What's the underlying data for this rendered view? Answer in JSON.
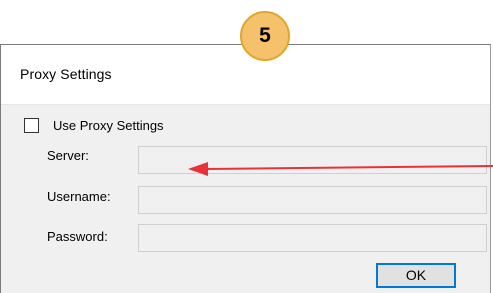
{
  "step_badge": "5",
  "dialog": {
    "title": "Proxy Settings",
    "use_proxy_label": "Use Proxy Settings",
    "use_proxy_checked": false,
    "fields": [
      {
        "label": "Server:",
        "value": ""
      },
      {
        "label": "Username:",
        "value": ""
      },
      {
        "label": "Password:",
        "value": ""
      }
    ],
    "ok_label": "OK"
  },
  "colors": {
    "annotation_arrow": "#e8323a",
    "badge_fill": "#f5c26b",
    "badge_border": "#e0a62c",
    "ok_border": "#0078d7"
  }
}
